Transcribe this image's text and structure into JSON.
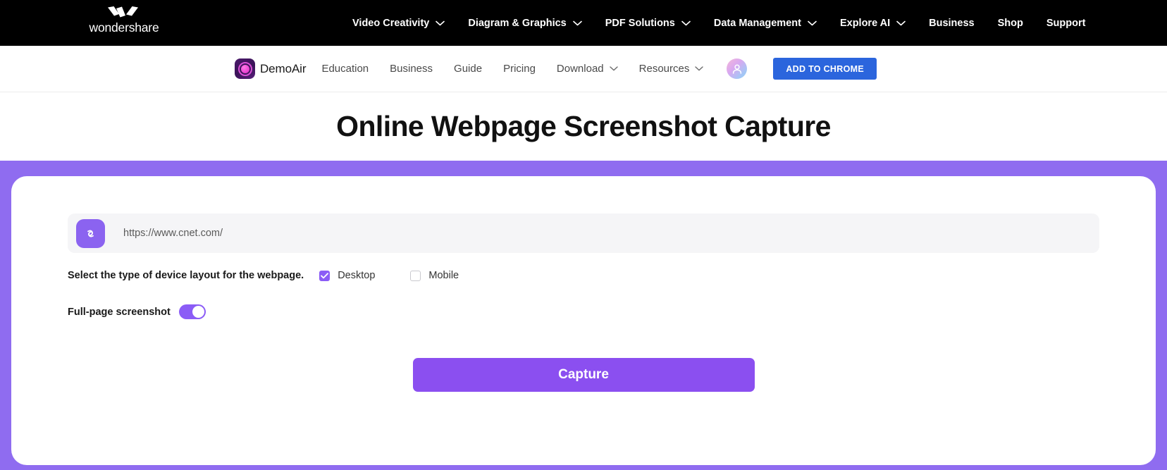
{
  "topnav": {
    "logo": {
      "icon_name": "wondershare-logo-icon",
      "wordmark": "wondershare"
    },
    "items": [
      {
        "label": "Video Creativity",
        "has_chevron": true
      },
      {
        "label": "Diagram & Graphics",
        "has_chevron": true
      },
      {
        "label": "PDF Solutions",
        "has_chevron": true
      },
      {
        "label": "Data Management",
        "has_chevron": true
      },
      {
        "label": "Explore AI",
        "has_chevron": true
      },
      {
        "label": "Business",
        "has_chevron": false
      },
      {
        "label": "Shop",
        "has_chevron": false
      },
      {
        "label": "Support",
        "has_chevron": false
      }
    ],
    "background_color": "#000000"
  },
  "subnav": {
    "brand": {
      "name": "DemoAir",
      "icon_name": "demoair-logo-icon"
    },
    "items": [
      {
        "label": "Education",
        "has_chevron": false
      },
      {
        "label": "Business",
        "has_chevron": false
      },
      {
        "label": "Guide",
        "has_chevron": false
      },
      {
        "label": "Pricing",
        "has_chevron": false
      },
      {
        "label": "Download",
        "has_chevron": true
      },
      {
        "label": "Resources",
        "has_chevron": true
      }
    ],
    "avatar_icon": "user-avatar-icon",
    "cta_label": "ADD TO CHROME",
    "cta_color": "#2b65dd"
  },
  "main": {
    "title": "Online Webpage Screenshot Capture",
    "accent_color": "#8f6cf0",
    "url_input": {
      "value": "https://www.cnet.com/",
      "placeholder": "https://www.cnet.com/",
      "icon_name": "link-icon"
    },
    "device": {
      "label": "Select the type of device layout for the webpage.",
      "options": [
        {
          "label": "Desktop",
          "checked": true
        },
        {
          "label": "Mobile",
          "checked": false
        }
      ]
    },
    "fullpage": {
      "label": "Full-page screenshot",
      "enabled": true
    },
    "capture_button": {
      "label": "Capture",
      "color": "#8b4ff0"
    }
  }
}
